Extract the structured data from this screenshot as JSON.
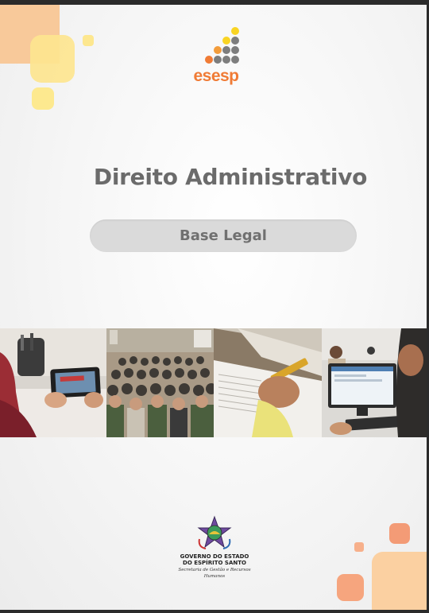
{
  "logo": {
    "text": "esesp"
  },
  "title": "Direito Administrativo",
  "subtitle": "Base Legal",
  "footer": {
    "line1": "GOVERNO DO ESTADO",
    "line2": "DO ESPÍRITO SANTO",
    "line3": "Secretaria de Gestão e Recursos Humanos"
  },
  "colors": {
    "accent_orange": "#f07b35",
    "accent_yellow": "#f9d423",
    "logo_gray": "#7a7a7a"
  },
  "icons": [
    "esesp-logo-dots",
    "espirito-santo-coat-of-arms"
  ]
}
